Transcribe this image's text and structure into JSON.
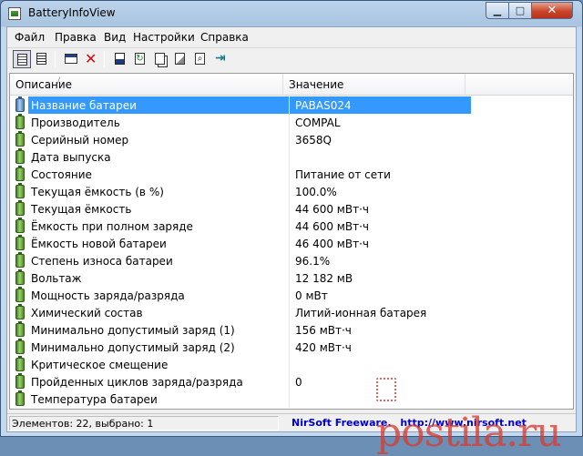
{
  "window": {
    "title": "BatteryInfoView"
  },
  "menu": [
    "Файл",
    "Правка",
    "Вид",
    "Настройки",
    "Справка"
  ],
  "toolbar": [
    {
      "name": "view-grid-icon"
    },
    {
      "name": "view-report-icon"
    },
    {
      "name": "properties-icon"
    },
    {
      "name": "delete-icon"
    },
    {
      "name": "save-icon"
    },
    {
      "name": "refresh-icon"
    },
    {
      "name": "copy-icon"
    },
    {
      "name": "html-report-icon"
    },
    {
      "name": "find-icon"
    },
    {
      "name": "exit-icon"
    }
  ],
  "columns": {
    "description": "Описание",
    "value": "Значение"
  },
  "rows": [
    {
      "label": "Название батареи",
      "value": "PABAS024",
      "selected": true
    },
    {
      "label": "Производитель",
      "value": "COMPAL"
    },
    {
      "label": "Серийный номер",
      "value": "3658Q"
    },
    {
      "label": "Дата выпуска",
      "value": ""
    },
    {
      "label": "Состояние",
      "value": "Питание от сети"
    },
    {
      "label": "Текущая ёмкость (в %)",
      "value": "100.0%"
    },
    {
      "label": "Текущая ёмкость",
      "value": "44 600 мВт·ч"
    },
    {
      "label": "Ёмкость при полном заряде",
      "value": "44 600 мВт·ч"
    },
    {
      "label": "Ёмкость новой батареи",
      "value": "46 400 мВт·ч"
    },
    {
      "label": "Степень износа батареи",
      "value": "96.1%"
    },
    {
      "label": "Вольтаж",
      "value": "12 182 мВ"
    },
    {
      "label": "Мощность заряда/разряда",
      "value": "0 мВт"
    },
    {
      "label": "Химический состав",
      "value": "Литий-ионная батарея"
    },
    {
      "label": "Минимально допустимый заряд (1)",
      "value": "156 мВт·ч"
    },
    {
      "label": "Минимально допустимый заряд (2)",
      "value": "420 мВт·ч"
    },
    {
      "label": "Критическое смещение",
      "value": ""
    },
    {
      "label": "Пройденных циклов заряда/разряда",
      "value": "0"
    },
    {
      "label": "Температура батареи",
      "value": ""
    }
  ],
  "status": {
    "left": "Элементов: 22, выбрано: 1",
    "brand": "NirSoft Freeware.",
    "url": "http://www.nirsoft.net"
  },
  "watermark": "postila.ru"
}
